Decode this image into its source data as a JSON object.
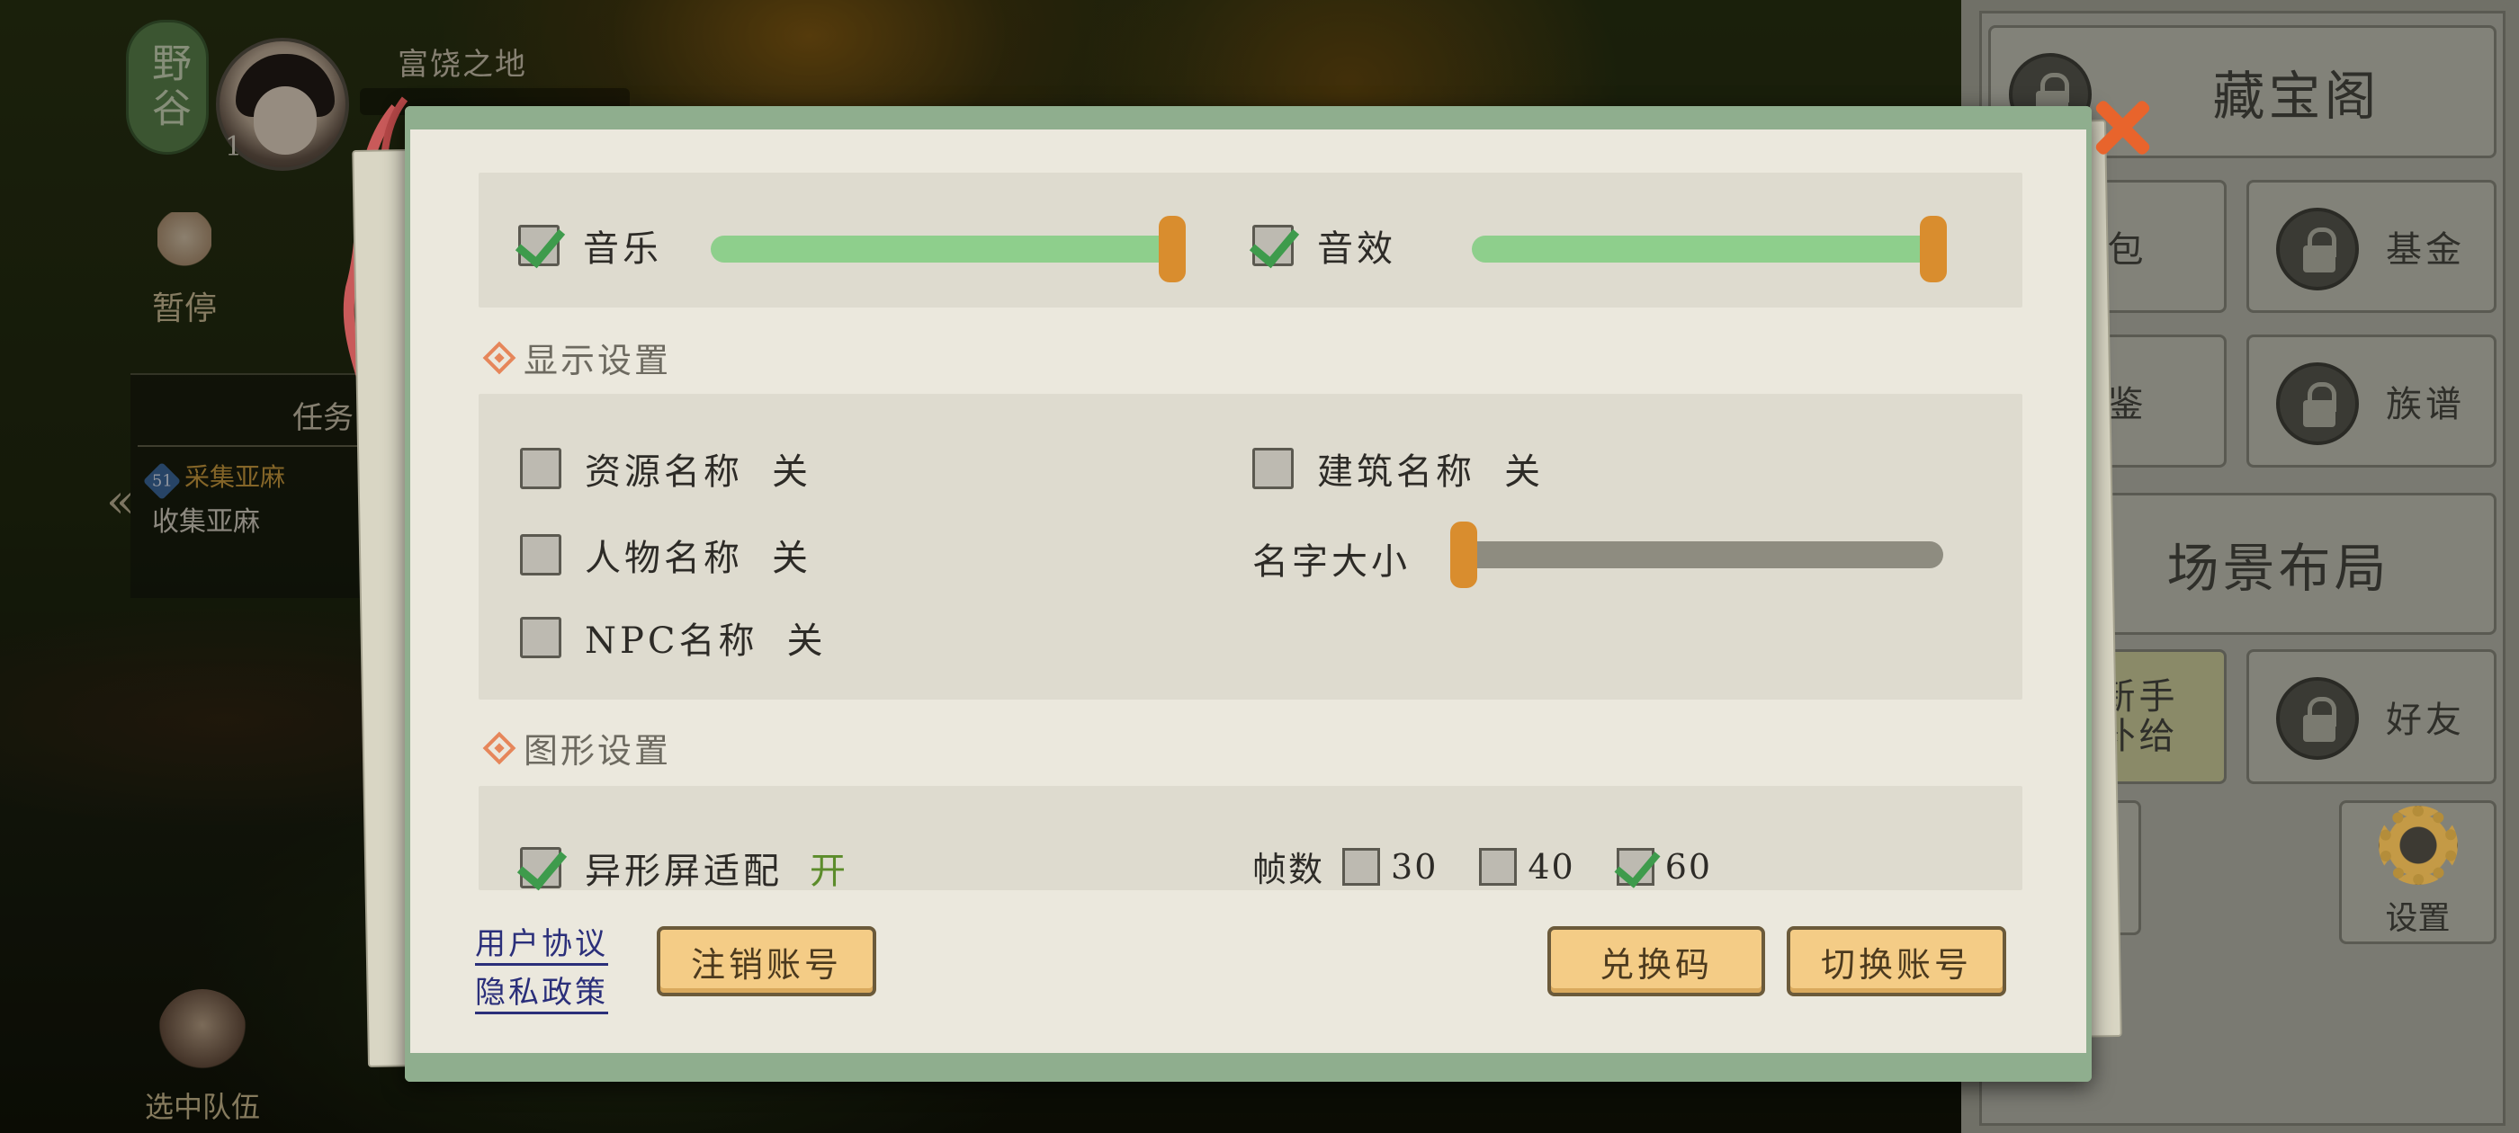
{
  "hud": {
    "region_label": "野谷",
    "place_name": "富饶之地",
    "level": "1",
    "pause_label": "暂停",
    "quest_title": "任务",
    "quest_number": "51",
    "quest_active": "采集亚麻",
    "quest_sub": "收集亚麻",
    "collapse_arrow": "«",
    "team_label": "选中队伍"
  },
  "right_menu": {
    "treasure": "藏宝阁",
    "gift": "礼包",
    "fund": "基金",
    "codex": "图鉴",
    "genealogy": "族谱",
    "scene_layout": "场景布局",
    "newbie_supply": "新手补给",
    "friends": "好友",
    "settings": "设置"
  },
  "settings": {
    "audio": {
      "music_label": "音乐",
      "music_checked": true,
      "music_volume": 1.0,
      "sfx_label": "音效",
      "sfx_checked": true,
      "sfx_volume": 1.0
    },
    "display_header": "显示设置",
    "display": {
      "resource_name_label": "资源名称",
      "resource_name_value": "关",
      "building_name_label": "建筑名称",
      "building_name_value": "关",
      "character_name_label": "人物名称",
      "character_name_value": "关",
      "npc_name_label": "NPC名称",
      "npc_name_value": "关",
      "name_size_label": "名字大小",
      "name_size": 0.0
    },
    "graphics_header": "图形设置",
    "graphics": {
      "notch_label": "异形屏适配",
      "notch_value": "开",
      "notch_checked": true,
      "fps_label": "帧数",
      "fps_options": [
        "30",
        "40",
        "60"
      ],
      "fps_selected": "60"
    },
    "footer": {
      "user_agreement": "用户协议",
      "privacy_policy": "隐私政策",
      "delete_account": "注销账号",
      "redeem_code": "兑换码",
      "switch_account": "切换账号"
    }
  },
  "colors": {
    "slider_fill": "#8ecf8c",
    "slider_empty": "#8e8c80",
    "handle": "#d98d2e",
    "check": "#3e9b4c",
    "accent_diamond": "#e6865a",
    "button_fill": "#f4cc86",
    "frame_green": "#8fae8e",
    "close_x": "#e8642c"
  },
  "icons": [
    "close-icon",
    "check-icon",
    "lock-icon",
    "gear-icon",
    "diamond-icon",
    "hand-icon",
    "double-chevron-left-icon"
  ]
}
